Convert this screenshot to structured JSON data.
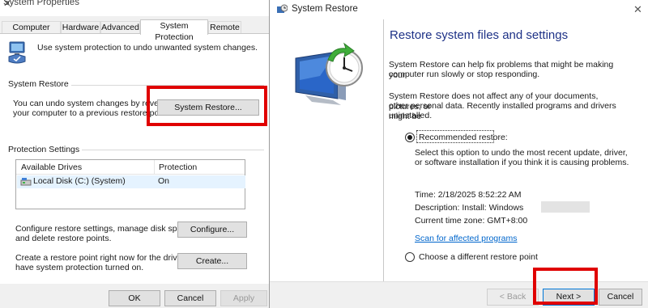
{
  "system_properties": {
    "title": "System Properties",
    "tabs": [
      "Computer Name",
      "Hardware",
      "Advanced",
      "System Protection",
      "Remote"
    ],
    "active_tab": "System Protection",
    "intro_text": "Use system protection to undo unwanted system changes.",
    "restore_group": {
      "label": "System Restore",
      "description_line1": "You can undo system changes by reverting",
      "description_line2": "your computer to a previous restore point.",
      "button": "System Restore..."
    },
    "protection_group": {
      "label": "Protection Settings",
      "columns": [
        "Available Drives",
        "Protection"
      ],
      "rows": [
        {
          "drive": "Local Disk (C:) (System)",
          "protection": "On"
        }
      ]
    },
    "configure": {
      "text_line1": "Configure restore settings, manage disk space,",
      "text_line2": "and delete restore points.",
      "button": "Configure..."
    },
    "create": {
      "text_line1": "Create a restore point right now for the drives that",
      "text_line2": "have system protection turned on.",
      "button": "Create..."
    },
    "footer_buttons": {
      "ok": "OK",
      "cancel": "Cancel",
      "apply": "Apply"
    }
  },
  "system_restore": {
    "title": "System Restore",
    "heading": "Restore system files and settings",
    "para1_line1": "System Restore can help fix problems that might be making your",
    "para1_line2": "computer run slowly or stop responding.",
    "para2_line1": "System Restore does not affect any of your documents, pictures, or",
    "para2_line2": "other personal data. Recently installed programs and drivers might be",
    "para2_line3": "uninstalled.",
    "recommended": {
      "label": "Recommended restore:",
      "selected": true,
      "desc_line1": "Select this option to undo the most recent update, driver,",
      "desc_line2": "or software installation if you think it is causing problems."
    },
    "details": {
      "time": "Time: 2/18/2025 8:52:22 AM",
      "description": "Description: Install: Windows",
      "timezone": "Current time zone: GMT+8:00"
    },
    "scan_link": "Scan for affected programs",
    "different": {
      "label": "Choose a different restore point",
      "selected": false
    },
    "buttons": {
      "back": "< Back",
      "next": "Next >",
      "cancel": "Cancel"
    }
  },
  "colors": {
    "highlight": "#e00000",
    "heading": "#1e3287",
    "link": "#0066cc"
  },
  "icons": [
    "shield-computer-icon",
    "drive-icon",
    "system-restore-clock-icon",
    "close-icon"
  ]
}
